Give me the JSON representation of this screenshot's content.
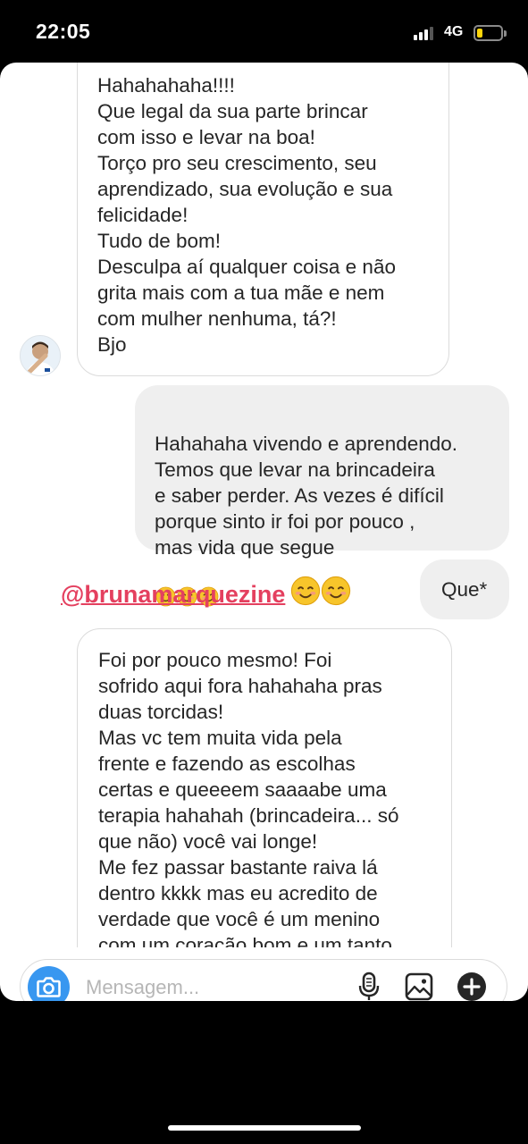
{
  "status_bar": {
    "time": "22:05",
    "network": "4G",
    "signal_bars": 3,
    "signal_max": 4,
    "battery_level": 0.22,
    "battery_color": "#ffd60a"
  },
  "conversation": {
    "msg1": "Hahahahaha!!!!\nQue legal da sua parte brincar\ncom isso e levar na boa!\nTorço pro seu crescimento, seu\naprendizado, sua evolução e sua\nfelicidade!\nTudo de bom!\nDesculpa aí qualquer coisa e não\ngrita mais com a tua mãe e nem\ncom mulher nenhuma, tá?!\nBjo",
    "msg2": "Hahahaha vivendo e aprendendo.\nTemos que levar na brincadeira\ne saber perder. As vezes é difícil\nporque sinto ir foi por pouco ,\nmas vida que segue",
    "msg2_emoji": "smiling-face-emoji",
    "msg3": "Que*",
    "msg4": "Foi por pouco mesmo! Foi\nsofrido aqui fora hahahaha pras\nduas torcidas!\nMas vc tem muita vida pela\nfrente e fazendo as escolhas\ncertas e queeeem saaaabe uma\nterapia hahahah (brincadeira... só\nque não) você vai longe!\nMe fez passar bastante raiva lá\ndentro kkkk mas eu acredito de\nverdade que você é um menino\ncom um coração bom e um tanto"
  },
  "mention": {
    "handle": "@brunamarquezine",
    "color": "#e4405f"
  },
  "composer": {
    "placeholder": "Mensagem...",
    "accent": "#3897f0"
  }
}
